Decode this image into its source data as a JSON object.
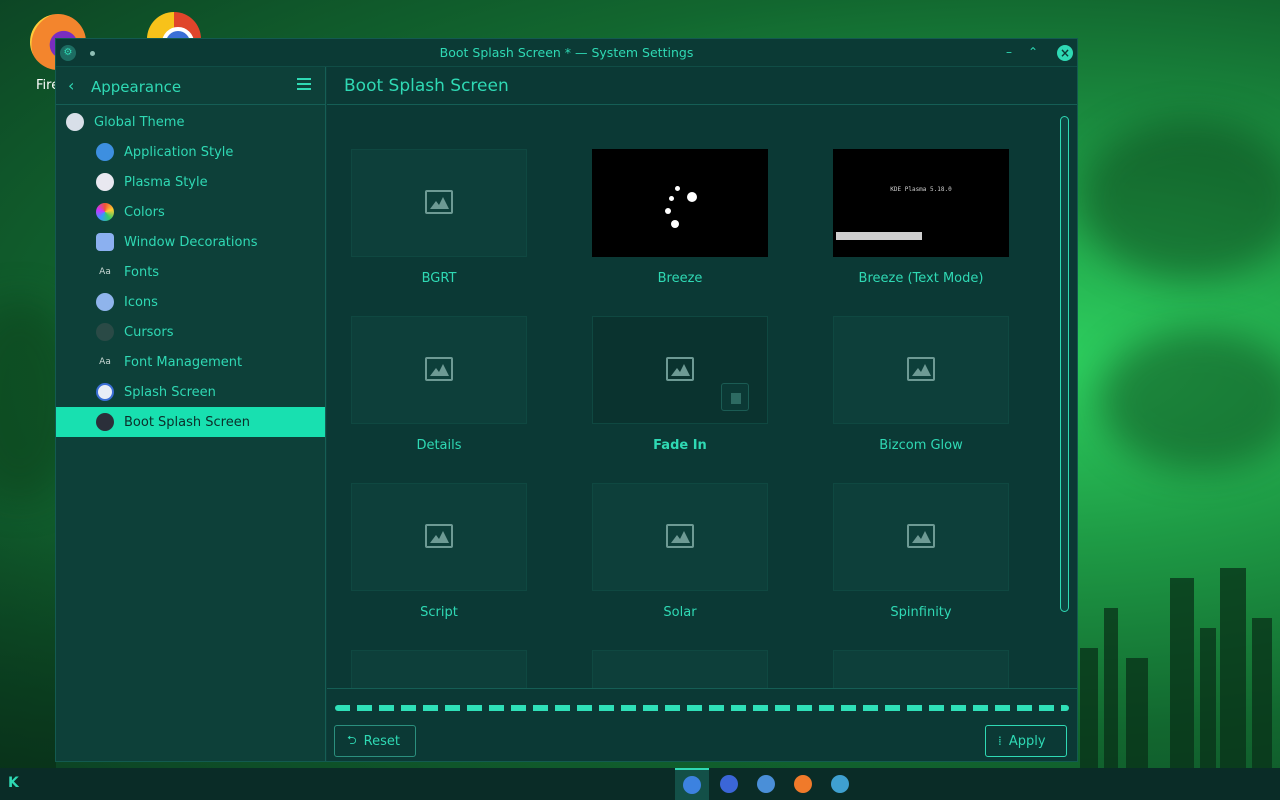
{
  "desktop": {
    "firefox_label": "Fire",
    "firefox_icon": "firefox-icon",
    "chrome_icon": "chrome-icon"
  },
  "window": {
    "title": "Boot Splash Screen * — System Settings",
    "minimize_glyph": "–",
    "maximize_glyph": "⌃",
    "close_glyph": "×"
  },
  "sidebar": {
    "back_glyph": "‹",
    "title": "Appearance",
    "items": [
      {
        "label": "Global Theme",
        "icon": "global-theme-icon",
        "level": "top"
      },
      {
        "label": "Application Style",
        "icon": "application-style-icon",
        "level": "child"
      },
      {
        "label": "Plasma Style",
        "icon": "plasma-style-icon",
        "level": "child"
      },
      {
        "label": "Colors",
        "icon": "colors-icon",
        "level": "child"
      },
      {
        "label": "Window Decorations",
        "icon": "window-decorations-icon",
        "level": "child"
      },
      {
        "label": "Fonts",
        "icon": "fonts-icon",
        "level": "child",
        "glyph": "Aa"
      },
      {
        "label": "Icons",
        "icon": "icons-icon",
        "level": "child"
      },
      {
        "label": "Cursors",
        "icon": "cursors-icon",
        "level": "child"
      },
      {
        "label": "Font Management",
        "icon": "font-management-icon",
        "level": "child",
        "glyph": "Aa"
      },
      {
        "label": "Splash Screen",
        "icon": "splash-screen-icon",
        "level": "child"
      },
      {
        "label": "Boot Splash Screen",
        "icon": "boot-splash-screen-icon",
        "level": "child",
        "active": true
      }
    ]
  },
  "main": {
    "title": "Boot Splash Screen",
    "themes": [
      {
        "label": "BGRT",
        "preview": "placeholder"
      },
      {
        "label": "Breeze",
        "preview": "breeze"
      },
      {
        "label": "Breeze (Text Mode)",
        "preview": "text-mode",
        "preview_text": "KDE Plasma 5.18.0"
      },
      {
        "label": "Details",
        "preview": "placeholder"
      },
      {
        "label": "Fade In",
        "preview": "placeholder",
        "selected": true
      },
      {
        "label": "Bizcom Glow",
        "preview": "placeholder"
      },
      {
        "label": "Script",
        "preview": "placeholder"
      },
      {
        "label": "Solar",
        "preview": "placeholder"
      },
      {
        "label": "Spinfinity",
        "preview": "placeholder"
      },
      {
        "label": "",
        "preview": "placeholder"
      },
      {
        "label": "",
        "preview": "placeholder"
      },
      {
        "label": "",
        "preview": "placeholder"
      }
    ],
    "reset_label": "Reset",
    "reset_glyph": "⮌",
    "apply_label": "Apply",
    "apply_glyph": "⁞"
  },
  "taskbar": {
    "logo": "K",
    "tasks": [
      {
        "name": "system-settings-task",
        "color": "#3c82e0",
        "active": true
      },
      {
        "name": "discover-task",
        "color": "#3b66d8"
      },
      {
        "name": "dolphin-task",
        "color": "#4a8fd8"
      },
      {
        "name": "firefox-task",
        "color": "#f07a2a"
      },
      {
        "name": "kde-connect-task",
        "color": "#3fa0d0"
      }
    ]
  },
  "colors": {
    "accent": "#2fd9b4",
    "active_row": "#18e0b0",
    "window_bg": "#0b3935"
  }
}
